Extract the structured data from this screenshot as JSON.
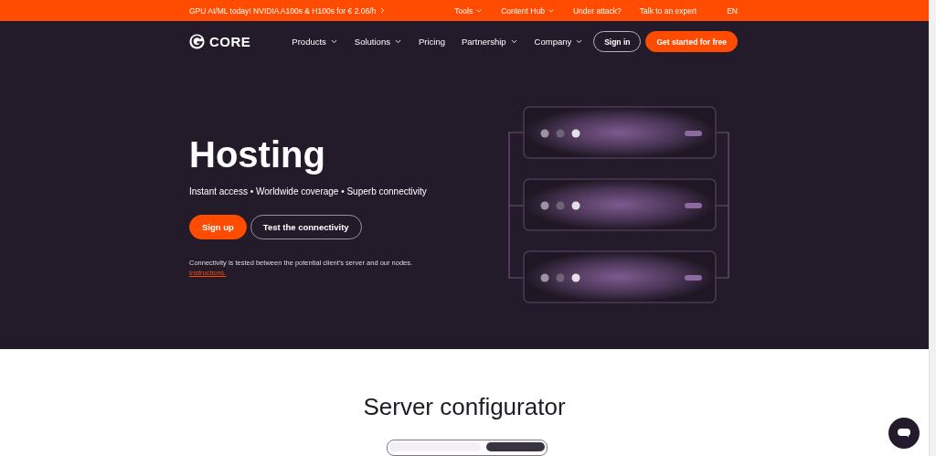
{
  "promo_bar": {
    "text": "GPU AI/ML today! NVIDIA A100s & H100s for € 2.06/h",
    "links": [
      {
        "label": "Tools",
        "has_menu": true
      },
      {
        "label": "Content Hub",
        "has_menu": true
      },
      {
        "label": "Under attack?",
        "has_menu": false
      },
      {
        "label": "Talk to an expert",
        "has_menu": false
      }
    ],
    "language": "EN"
  },
  "nav": {
    "logo": "CORE",
    "items": [
      {
        "label": "Products",
        "has_menu": true
      },
      {
        "label": "Solutions",
        "has_menu": true
      },
      {
        "label": "Pricing",
        "has_menu": false
      },
      {
        "label": "Partnership",
        "has_menu": true
      },
      {
        "label": "Company",
        "has_menu": true
      }
    ],
    "sign_in": "Sign in",
    "cta": "Get started for free"
  },
  "hero": {
    "title": "Hosting",
    "subtitle": "Instant access • Worldwide coverage • Superb connectivity",
    "buttons": [
      {
        "label": "Sign up",
        "kind": "primary"
      },
      {
        "label": "Test the connectivity",
        "kind": "outline"
      }
    ],
    "note": "Connectivity is tested between the potential client's server and our nodes.",
    "note_link": "Instructions."
  },
  "configurator": {
    "title": "Server configurator",
    "segments": [
      {
        "selected": false
      },
      {
        "selected": true
      }
    ]
  }
}
